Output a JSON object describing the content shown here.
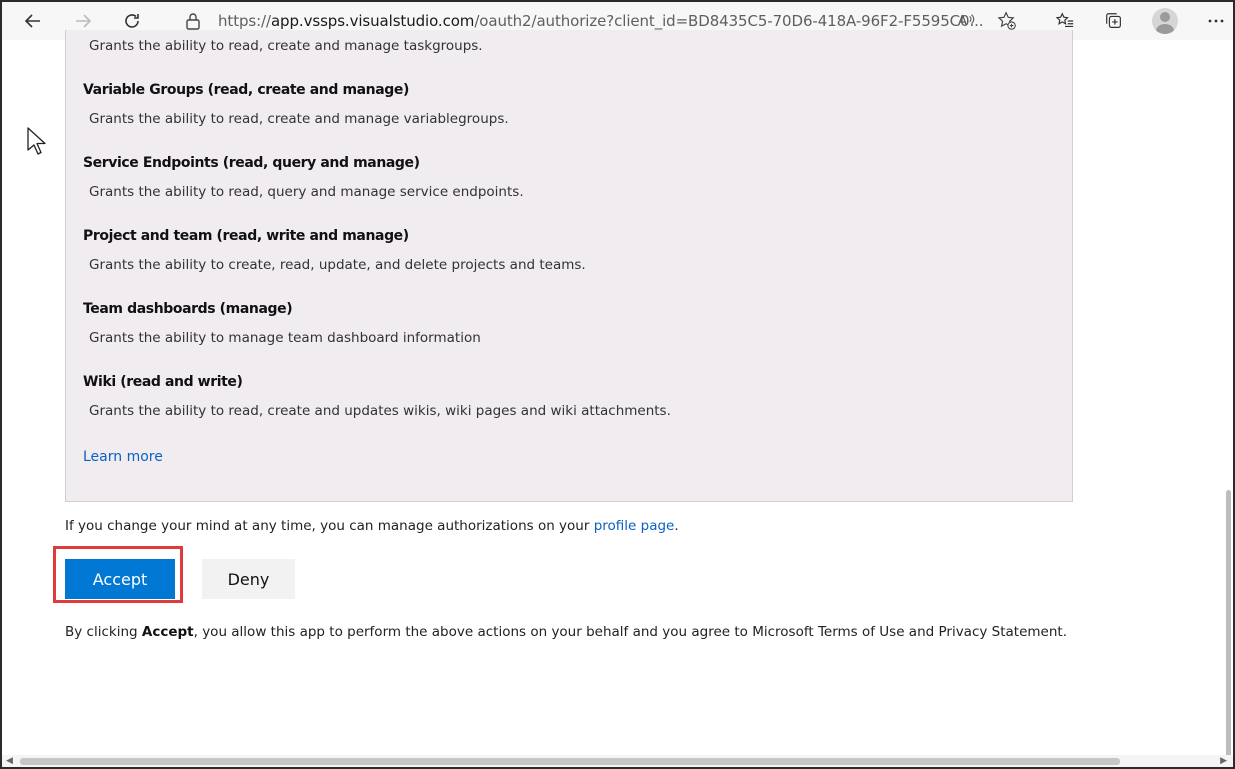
{
  "browser": {
    "url_prefix": "https://",
    "url_host": "app.vssps.visualstudio.com",
    "url_path": "/oauth2/authorize?client_id=BD8435C5-70D6-418A-96F2-F5595C0..."
  },
  "scopes": {
    "top_desc": "Grants the ability to read, create and manage taskgroups.",
    "items": [
      {
        "title": "Variable Groups (read, create and manage)",
        "desc": "Grants the ability to read, create and manage variablegroups."
      },
      {
        "title": "Service Endpoints (read, query and manage)",
        "desc": "Grants the ability to read, query and manage service endpoints."
      },
      {
        "title": "Project and team (read, write and manage)",
        "desc": "Grants the ability to create, read, update, and delete projects and teams."
      },
      {
        "title": "Team dashboards (manage)",
        "desc": "Grants the ability to manage team dashboard information"
      },
      {
        "title": "Wiki (read and write)",
        "desc": "Grants the ability to read, create and updates wikis, wiki pages and wiki attachments."
      }
    ],
    "learn_more": "Learn more"
  },
  "note": {
    "text": "If you change your mind at any time, you can manage authorizations on your ",
    "link": "profile page",
    "end": "."
  },
  "actions": {
    "accept_label": "Accept",
    "deny_label": "Deny"
  },
  "consent": {
    "prefix": "By clicking ",
    "bold": "Accept",
    "suffix": ", you allow this app to perform the above actions on your behalf and you agree to Microsoft Terms of Use and Privacy Statement."
  },
  "colors": {
    "accent": "#0078d4",
    "link": "#0b61c4",
    "highlight": "#e03a3a",
    "panel": "#f0ecf0"
  }
}
